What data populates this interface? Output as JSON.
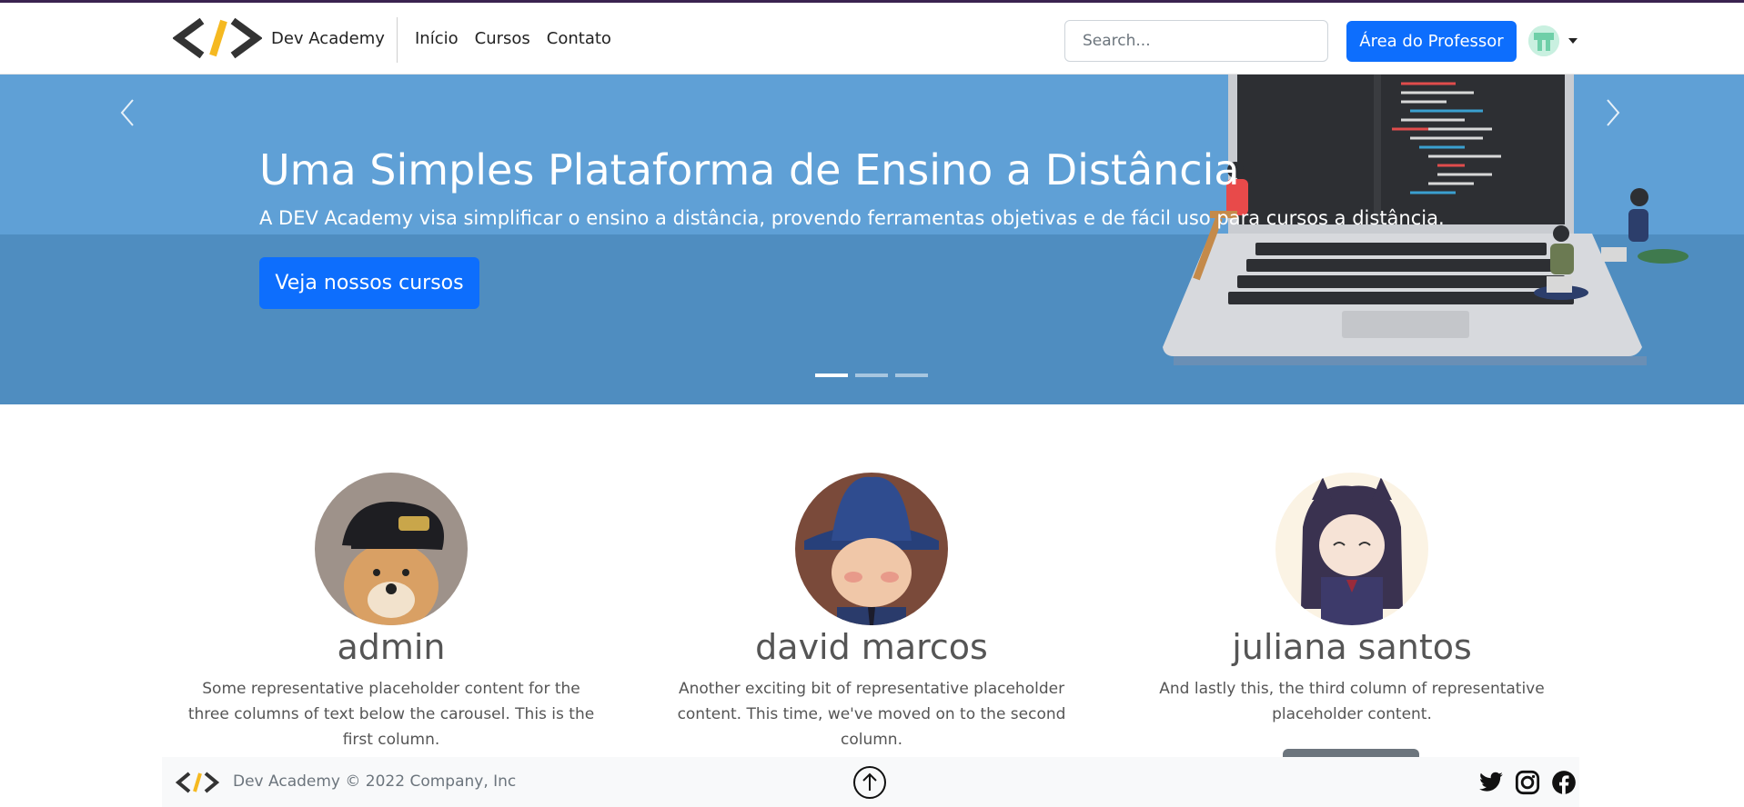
{
  "navbar": {
    "brand_name": "Dev Academy",
    "links": [
      "Início",
      "Cursos",
      "Contato"
    ],
    "search_placeholder": "Search...",
    "professor_button": "Área do Professor"
  },
  "hero": {
    "title": "Uma Simples Plataforma de Ensino a Distância",
    "text": "A DEV Academy visa simplificar o ensino a distância, provendo ferramentas objetivas e de fácil uso para cursos a distância.",
    "button": "Veja nossos cursos",
    "slides": 3,
    "active_slide": 1
  },
  "profiles": [
    {
      "name": "admin",
      "desc": "Some representative placeholder content for the three columns of text below the carousel. This is the first column."
    },
    {
      "name": "david marcos",
      "desc": "Another exciting bit of representative placeholder content. This time, we've moved on to the second column."
    },
    {
      "name": "juliana santos",
      "desc": "And lastly this, the third column of representative placeholder content."
    }
  ],
  "footer": {
    "text": "Dev Academy © 2022 Company, Inc"
  },
  "colors": {
    "primary": "#0d6efd",
    "hero_bg": "#5b9bd0",
    "logo_yellow": "#f5b921",
    "logo_dark": "#333333"
  },
  "icons": [
    "logo-icon",
    "chevron-left-icon",
    "chevron-right-icon",
    "arrow-up-icon",
    "twitter-icon",
    "instagram-icon",
    "facebook-icon"
  ]
}
